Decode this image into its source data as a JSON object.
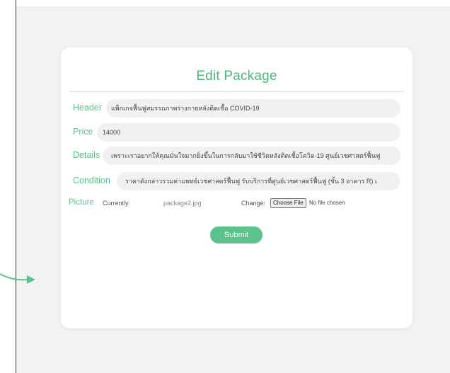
{
  "form": {
    "title": "Edit Package",
    "header": {
      "label": "Header",
      "value": "แพ็กเกจฟื้นฟูสมรรถภาพร่างกายหลังติดเชื้อ COVID-19"
    },
    "price": {
      "label": "Price",
      "value": "14000"
    },
    "details": {
      "label": "Details",
      "value": "เพราะเราอยากให้คุณมั่นใจมากยิ่งขึ้นในการกลับมาใช้ชีวิตหลังติดเชื้อโควิด-19 ศูนย์เวชศาสตร์ฟื้นฟู"
    },
    "condition": {
      "label": "Condition",
      "value": "ราคาดังกล่าวรวมค่าแพทย์เวชศาสตร์ฟื้นฟู รับบริการที่ศูนย์เวชศาสตร์ฟื้นฟู (ชั้น 3 อาคาร R) เ"
    },
    "picture": {
      "label": "Picture",
      "currently_label": "Currently:",
      "current_file": "package2.jpg",
      "change_label": "Change:",
      "choose_file_label": "Choose File",
      "no_file_text": "No file chosen"
    },
    "submit_label": "Submit"
  },
  "colors": {
    "accent": "#5cc28b",
    "title": "#4bb879"
  },
  "decor": {
    "arrow_icon": "arrow-right-icon"
  }
}
